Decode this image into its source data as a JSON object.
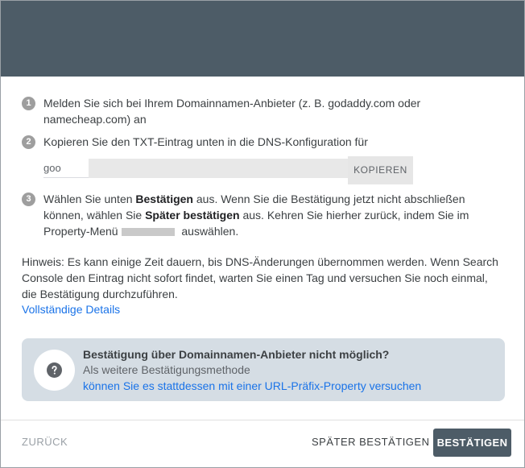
{
  "steps": [
    {
      "num": "1",
      "text": "Melden Sie sich bei Ihrem Domainnamen-Anbieter (z. B. godaddy.com oder namecheap.com) an"
    },
    {
      "num": "2",
      "text": "Kopieren Sie den TXT-Eintrag unten in die DNS-Konfiguration für"
    },
    {
      "num": "3",
      "text_parts": {
        "p1": "Wählen Sie unten ",
        "b1": "Bestätigen",
        "p2": " aus. Wenn Sie die Bestätigung jetzt nicht abschließen können, wählen Sie ",
        "b2": "Später bestätigen",
        "p3": " aus. Kehren Sie hierher zurück, indem Sie im Property-Menü",
        "p4": "auswählen."
      }
    }
  ],
  "txt_record": {
    "value_visible": "goo",
    "copy_label": "KOPIEREN"
  },
  "hint": {
    "text": "Hinweis: Es kann einige Zeit dauern, bis DNS-Änderungen übernommen werden. Wenn Search Console den Eintrag nicht sofort findet, warten Sie einen Tag und versuchen Sie noch einmal, die Bestätigung durchzuführen.",
    "link": "Vollständige Details"
  },
  "info_card": {
    "title": "Bestätigung über Domainnamen-Anbieter nicht möglich?",
    "subtitle": "Als weitere Bestätigungsmethode",
    "link": "können Sie es stattdessen mit einer URL-Präfix-Property versuchen",
    "icon": "help-circle-icon"
  },
  "footer": {
    "back_label": "ZURÜCK",
    "later_label": "SPÄTER BESTÄTIGEN",
    "confirm_label": "BESTÄTIGEN"
  },
  "colors": {
    "header": "#4d5c67",
    "accent_link": "#1a73e8",
    "card_bg": "#d5dde4",
    "step_badge": "#9e9e9e"
  }
}
